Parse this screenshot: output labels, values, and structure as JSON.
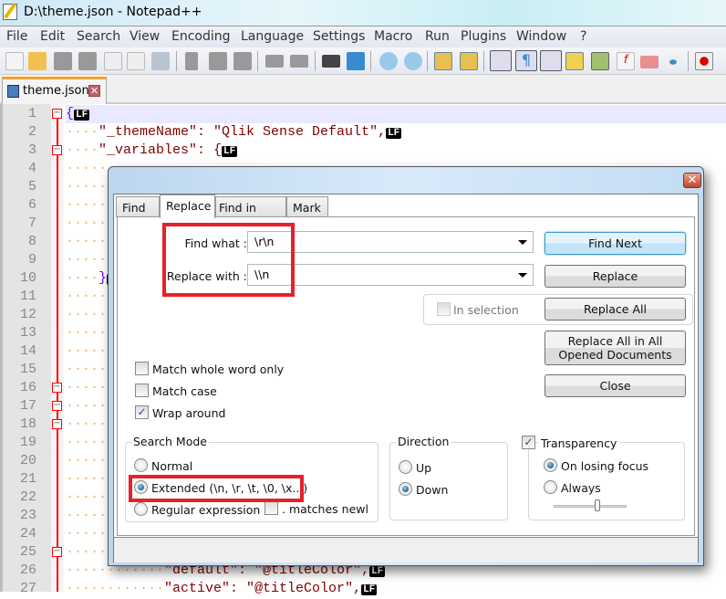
{
  "window": {
    "title": "D:\\theme.json - Notepad++"
  },
  "menu": [
    "File",
    "Edit",
    "Search",
    "View",
    "Encoding",
    "Language",
    "Settings",
    "Macro",
    "Run",
    "Plugins",
    "Window",
    "?"
  ],
  "toolbar_icons": [
    "new-file-icon",
    "open-file-icon",
    "save-icon",
    "save-all-icon",
    "close-icon",
    "close-all-icon",
    "print-icon",
    "cut-icon",
    "copy-icon",
    "paste-icon",
    "undo-icon",
    "redo-icon",
    "find-icon",
    "replace-icon",
    "zoom-in-icon",
    "zoom-out-icon",
    "sync-vertical-icon",
    "sync-horizontal-icon",
    "word-wrap-icon",
    "show-all-chars-icon",
    "indent-guide-icon",
    "user-language-icon",
    "document-map-icon",
    "function-list-icon",
    "folder-workspace-icon",
    "monitoring-icon",
    "record-macro-icon"
  ],
  "tab": {
    "label": "theme.json",
    "close": "✕"
  },
  "editor": {
    "line_numbers": [
      1,
      2,
      3,
      4,
      5,
      6,
      7,
      8,
      9,
      10,
      11,
      12,
      13,
      14,
      15,
      16,
      17,
      18,
      19,
      20,
      21,
      22,
      23,
      24,
      25,
      26,
      27
    ],
    "eol_marker": "LF",
    "lines": {
      "1": "{",
      "2": "\"_themeName\": \"Qlik Sense Default\",",
      "3": "\"_variables\": {",
      "10": "}",
      "26": "\"default\": \"@titleColor\",",
      "27": "\"active\": \"@titleColor\","
    }
  },
  "dialog": {
    "close": "✕",
    "tabs": [
      "Find",
      "Replace",
      "Find in Files",
      "Mark"
    ],
    "active_tab": "Replace",
    "find_what_label": "Find what :",
    "find_what_value": "\\r\\n",
    "replace_with_label": "Replace with :",
    "replace_with_value": "\\\\n",
    "in_selection": {
      "label": "In selection",
      "checked": false
    },
    "buttons": {
      "find_next": "Find Next",
      "replace": "Replace",
      "replace_all": "Replace All",
      "replace_all_opened": "Replace All in All Opened Documents",
      "close": "Close"
    },
    "options": {
      "match_whole_word": {
        "label": "Match whole word only",
        "checked": false
      },
      "match_case": {
        "label": "Match case",
        "checked": false
      },
      "wrap_around": {
        "label": "Wrap around",
        "checked": true
      }
    },
    "search_mode": {
      "title": "Search Mode",
      "normal": "Normal",
      "extended": "Extended (\\n, \\r, \\t, \\0, \\x...)",
      "regex": "Regular expression",
      "dot_newline": ". matches newlin",
      "selected": "extended",
      "dot_newline_checked": false
    },
    "direction": {
      "title": "Direction",
      "up": "Up",
      "down": "Down",
      "selected": "down"
    },
    "transparency": {
      "title": "Transparency",
      "checked": true,
      "on_losing_focus": "On losing focus",
      "always": "Always",
      "selected": "on_losing_focus",
      "slider_level": 0.6
    }
  },
  "colors": {
    "highlight_box": "#e8202a",
    "fold_line": "#ff0000",
    "string": "#800000",
    "operator": "#8000ff"
  }
}
